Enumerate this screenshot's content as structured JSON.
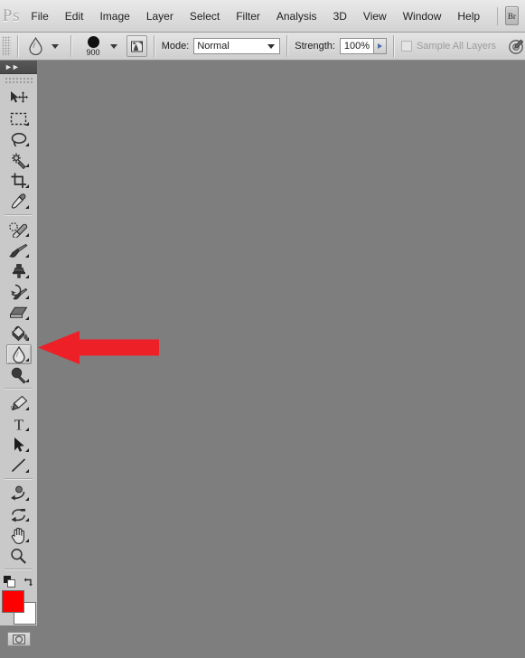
{
  "app": {
    "logo": "Ps",
    "bridge_button": "Br"
  },
  "menubar": {
    "items": [
      {
        "label": "File",
        "name": "menu-file"
      },
      {
        "label": "Edit",
        "name": "menu-edit"
      },
      {
        "label": "Image",
        "name": "menu-image"
      },
      {
        "label": "Layer",
        "name": "menu-layer"
      },
      {
        "label": "Select",
        "name": "menu-select"
      },
      {
        "label": "Filter",
        "name": "menu-filter"
      },
      {
        "label": "Analysis",
        "name": "menu-analysis"
      },
      {
        "label": "3D",
        "name": "menu-3d"
      },
      {
        "label": "View",
        "name": "menu-view"
      },
      {
        "label": "Window",
        "name": "menu-window"
      },
      {
        "label": "Help",
        "name": "menu-help"
      }
    ]
  },
  "options_bar": {
    "tool_preset_icon": "droplet-icon",
    "brush_size": "900",
    "brush_panel_toggle_icon": "toggle-brush-panel-icon",
    "mode_label": "Mode:",
    "mode_value": "Normal",
    "strength_label": "Strength:",
    "strength_value": "100%",
    "sample_all_layers_label": "Sample All Layers",
    "sample_all_layers_checked": false,
    "sample_all_layers_enabled": false,
    "tablet_pressure_icon": "tablet-pressure-icon"
  },
  "toolbar": {
    "collapse_icon": "double-chevron-right-icon",
    "tools": [
      {
        "name": "tool-move",
        "label": "Move Tool",
        "icon": "move-icon",
        "selected": false,
        "has_flyout": false
      },
      {
        "name": "tool-marquee",
        "label": "Rectangular Marquee Tool",
        "icon": "marquee-icon",
        "selected": false,
        "has_flyout": true
      },
      {
        "name": "tool-lasso",
        "label": "Lasso Tool",
        "icon": "lasso-icon",
        "selected": false,
        "has_flyout": true
      },
      {
        "name": "tool-quick-selection",
        "label": "Magic Wand Tool",
        "icon": "magic-wand-icon",
        "selected": false,
        "has_flyout": true
      },
      {
        "name": "tool-crop",
        "label": "Crop Tool",
        "icon": "crop-icon",
        "selected": false,
        "has_flyout": true
      },
      {
        "name": "tool-eyedropper",
        "label": "Eyedropper Tool",
        "icon": "eyedropper-icon",
        "selected": false,
        "has_flyout": true
      },
      {
        "name": "tool-healing-brush",
        "label": "Spot Healing Brush Tool",
        "icon": "healing-brush-icon",
        "selected": false,
        "has_flyout": true
      },
      {
        "name": "tool-brush",
        "label": "Brush Tool",
        "icon": "brush-icon",
        "selected": false,
        "has_flyout": true
      },
      {
        "name": "tool-clone-stamp",
        "label": "Clone Stamp Tool",
        "icon": "clone-stamp-icon",
        "selected": false,
        "has_flyout": true
      },
      {
        "name": "tool-history-brush",
        "label": "History Brush Tool",
        "icon": "history-brush-icon",
        "selected": false,
        "has_flyout": true
      },
      {
        "name": "tool-eraser",
        "label": "Eraser Tool",
        "icon": "eraser-icon",
        "selected": false,
        "has_flyout": true
      },
      {
        "name": "tool-paint-bucket",
        "label": "Gradient / Paint Bucket Tool",
        "icon": "paint-bucket-icon",
        "selected": false,
        "has_flyout": true
      },
      {
        "name": "tool-blur",
        "label": "Blur Tool",
        "icon": "droplet-icon",
        "selected": true,
        "has_flyout": true
      },
      {
        "name": "tool-dodge",
        "label": "Dodge Tool",
        "icon": "dodge-icon",
        "selected": false,
        "has_flyout": true
      },
      {
        "name": "tool-pen",
        "label": "Pen Tool",
        "icon": "pen-icon",
        "selected": false,
        "has_flyout": true
      },
      {
        "name": "tool-type",
        "label": "Horizontal Type Tool",
        "icon": "type-t-icon",
        "selected": false,
        "has_flyout": true
      },
      {
        "name": "tool-path-selection",
        "label": "Path Selection Tool",
        "icon": "path-arrow-icon",
        "selected": false,
        "has_flyout": true
      },
      {
        "name": "tool-line",
        "label": "Line Tool",
        "icon": "line-icon",
        "selected": false,
        "has_flyout": true
      },
      {
        "name": "tool-3d-rotate",
        "label": "3D Object Rotate Tool",
        "icon": "3d-rotate-icon",
        "selected": false,
        "has_flyout": true
      },
      {
        "name": "tool-3d-orbit",
        "label": "3D Rotate Camera Tool",
        "icon": "3d-orbit-icon",
        "selected": false,
        "has_flyout": true
      },
      {
        "name": "tool-hand",
        "label": "Hand Tool",
        "icon": "hand-icon",
        "selected": false,
        "has_flyout": true
      },
      {
        "name": "tool-zoom",
        "label": "Zoom Tool",
        "icon": "zoom-magnifier-icon",
        "selected": false,
        "has_flyout": false
      }
    ],
    "default_colors_icon": "default-colors-icon",
    "swap_colors_icon": "swap-colors-icon",
    "foreground_color": "#ff0000",
    "background_color": "#ffffff",
    "quick_mask_icon": "quick-mask-icon"
  },
  "canvas": {
    "background_color": "#7e7e7e"
  },
  "annotation": {
    "type": "arrow",
    "direction": "left",
    "color": "#ed2028",
    "points_to": "tool-blur"
  }
}
